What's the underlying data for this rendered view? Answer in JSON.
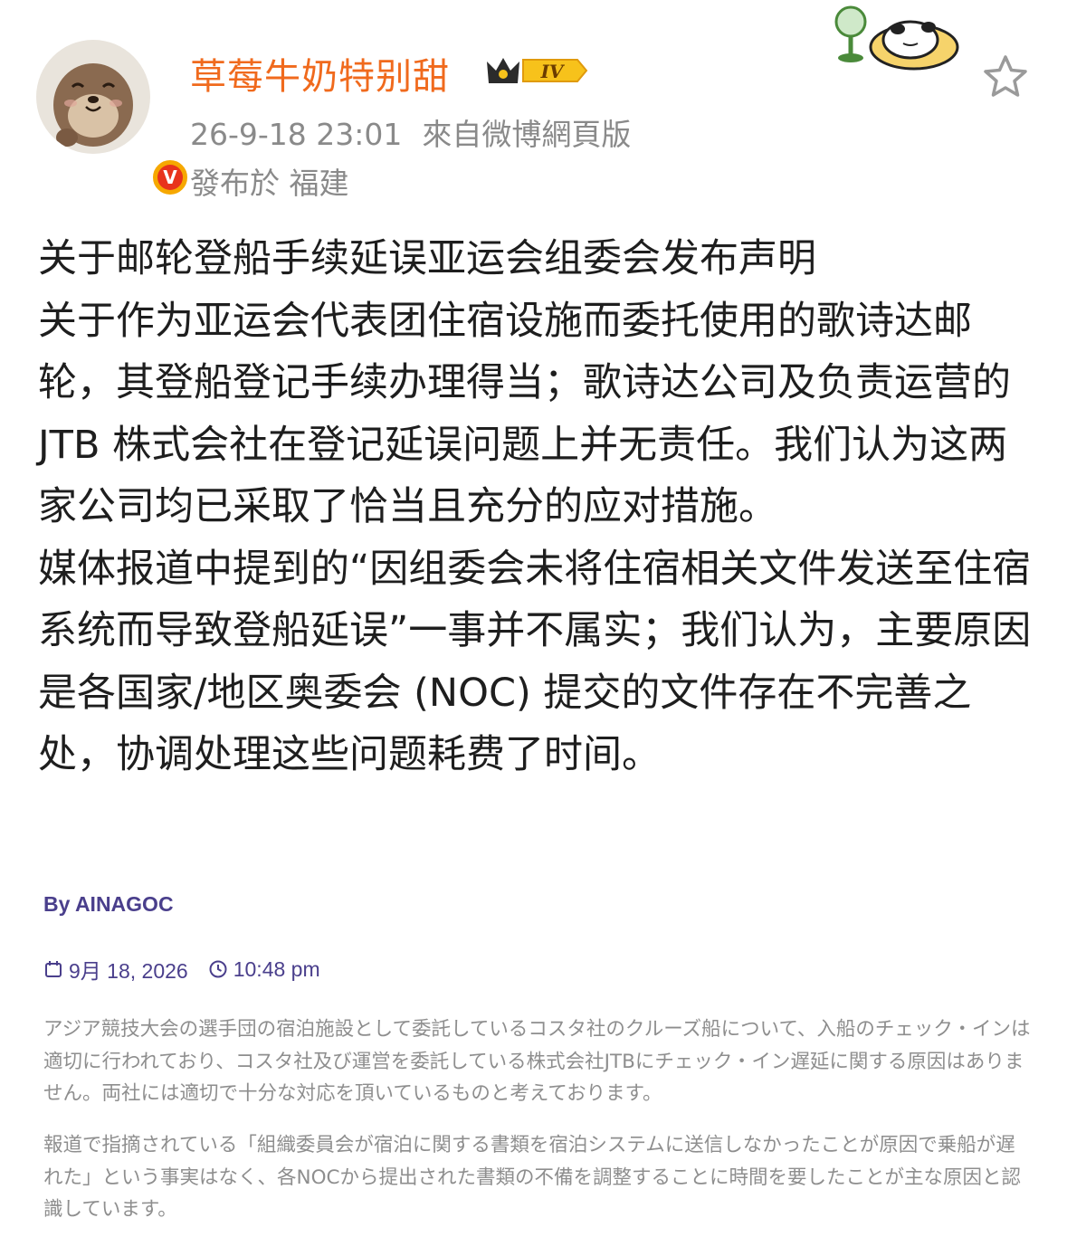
{
  "header": {
    "username": "草莓牛奶特别甜",
    "level_badge": "IV",
    "timestamp": "26-9-18 23:01",
    "source": "來自微博網頁版",
    "location": "發布於 福建",
    "avatar_icon": "otter-avatar-icon",
    "verified_badge": "V"
  },
  "post": {
    "paragraphs": [
      "关于邮轮登船手续延误亚运会组委会发布声明",
      "关于作为亚运会代表团住宿设施而委托使用的歌诗达邮轮，其登船登记手续办理得当；歌诗达公司及负责运营的 JTB 株式会社在登记延误问题上并无责任。我们认为这两家公司均已采取了恰当且充分的应对措施。",
      "媒体报道中提到的“因组委会未将住宿相关文件发送至住宿系统而导致登船延误”一事并不属实；我们认为，主要原因是各国家/地区奥委会 (NOC) 提交的文件存在不完善之处，协调处理这些问题耗费了时间。"
    ]
  },
  "article": {
    "byline": "By AINAGOC",
    "date": "9月 18, 2026",
    "time": "10:48 pm",
    "jp_paragraphs": [
      "アジア競技大会の選手団の宿泊施設として委託しているコスタ社のクルーズ船について、入船のチェック・インは適切に行われており、コスタ社及び運営を委託している株式会社JTBにチェック・イン遅延に関する原因はありません。両社には適切で十分な対応を頂いているものと考えております。",
      "報道で指摘されている「組織委員会が宿泊に関する書類を宿泊システムに送信しなかったことが原因で乗船が遅れた」という事実はなく、各NOCから提出された書類の不備を調整することに時間を要したことが主な原因と認識しています。"
    ]
  },
  "colors": {
    "username": "#f06a1d",
    "meta": "#8a8a8a",
    "body_text": "#1e1e1e",
    "article_meta": "#4a3f8c",
    "jp_text": "#8e8e8e"
  }
}
